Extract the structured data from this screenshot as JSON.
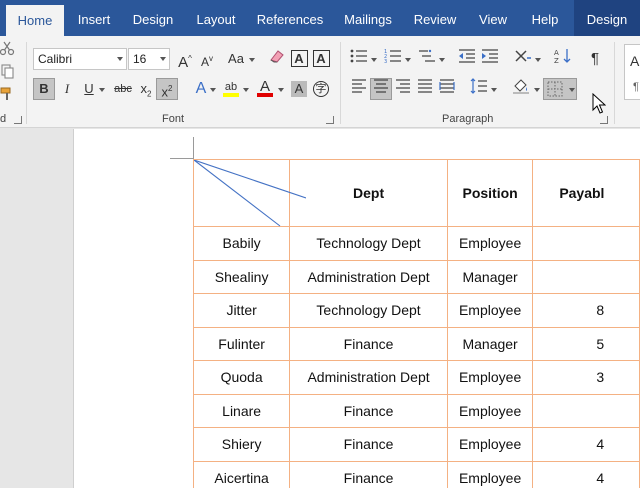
{
  "ribbon_tabs": [
    "Home",
    "Insert",
    "Design",
    "Layout",
    "References",
    "Mailings",
    "Review",
    "View",
    "Help",
    "Design"
  ],
  "font": {
    "family": "Calibri",
    "size": "16",
    "group_label": "Font"
  },
  "paragraph": {
    "group_label": "Paragraph"
  },
  "clipboard": {
    "group_label_fragment": "d"
  },
  "icons": {
    "grow": "A",
    "shrink": "A",
    "case": "Aa",
    "bold": "B",
    "italic": "I",
    "underline": "U",
    "strike": "abc",
    "subscript": "x",
    "superscript": "x",
    "text_effects": "A",
    "highlight": "ab",
    "font_color": "A",
    "char_shading": "A",
    "enclose": "字",
    "border_char": "A",
    "pilcrow": "¶",
    "styles_preview": "A"
  },
  "colors": {
    "accent": "#2b579a",
    "context_tab": "#1f4380",
    "table_border": "#f4b183",
    "highlight_yellow": "#ffff00",
    "font_red": "#e00000"
  },
  "table": {
    "headers": [
      "",
      "Dept",
      "Position",
      "Payabl"
    ],
    "rows": [
      [
        "Babily",
        "Technology Dept",
        "Employee",
        ""
      ],
      [
        "Shealiny",
        "Administration Dept",
        "Manager",
        ""
      ],
      [
        "Jitter",
        "Technology Dept",
        "Employee",
        "8"
      ],
      [
        "Fulinter",
        "Finance",
        "Manager",
        "5"
      ],
      [
        "Quoda",
        "Administration Dept",
        "Employee",
        "3"
      ],
      [
        "Linare",
        "Finance",
        "Employee",
        ""
      ],
      [
        "Shiery",
        "Finance",
        "Employee",
        "4"
      ],
      [
        "Aicertina",
        "Finance",
        "Employee",
        "4"
      ]
    ]
  }
}
